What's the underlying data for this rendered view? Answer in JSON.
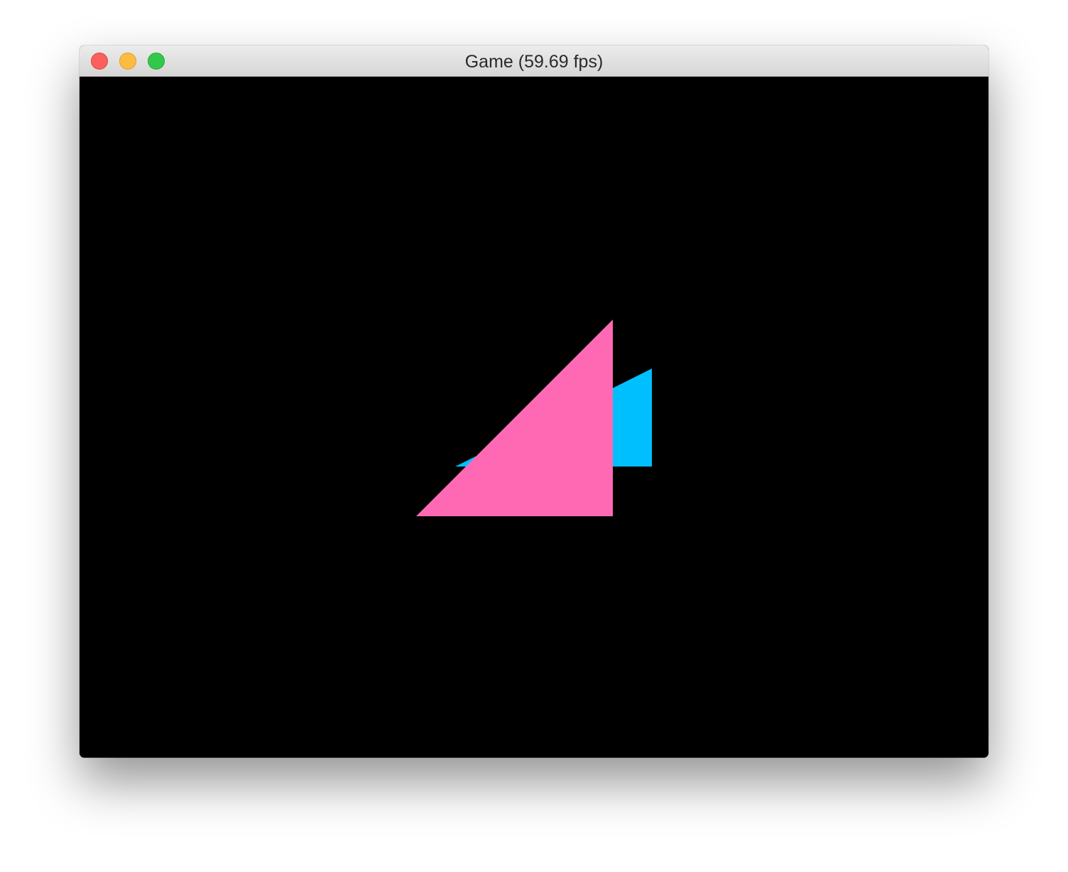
{
  "window": {
    "title": "Game (59.69 fps)"
  },
  "colors": {
    "canvas_background": "#000000",
    "front_triangle": "#ff69b4",
    "back_triangle": "#00bfff"
  },
  "icons": {
    "close": "close-icon",
    "minimize": "minimize-icon",
    "zoom": "zoom-icon"
  }
}
